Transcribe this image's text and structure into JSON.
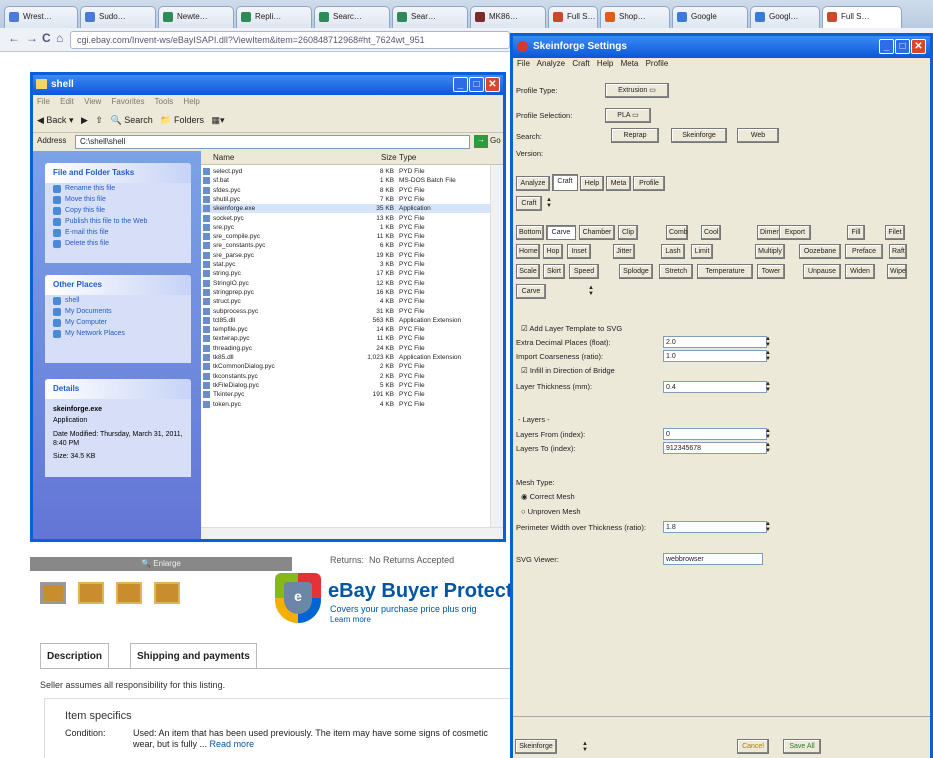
{
  "browser": {
    "tabs": [
      {
        "label": "Wrest…",
        "color": "#4b7bd4"
      },
      {
        "label": "Sudo…",
        "color": "#4b7bd4"
      },
      {
        "label": "Newte…",
        "color": "#2e8b57"
      },
      {
        "label": "Repli…",
        "color": "#2e8b57"
      },
      {
        "label": "Searc…",
        "color": "#2e8b57"
      },
      {
        "label": "Sear…",
        "color": "#2e8b57"
      },
      {
        "label": "MK86…",
        "color": "#7a2c2c"
      },
      {
        "label": "Full S…",
        "color": "#c94a2a"
      },
      {
        "label": "Shop…",
        "color": "#e35a1a"
      },
      {
        "label": "Google",
        "color": "#3a7bd5"
      },
      {
        "label": "Googl…",
        "color": "#3a7bd5"
      },
      {
        "label": "Full S…",
        "color": "#c94a2a"
      }
    ],
    "url": "cgi.ebay.com/Invent-ws/eBayISAPI.dll?ViewItem&item=260848712968#ht_7624wt_951"
  },
  "explorer": {
    "title": "shell",
    "menu": "File Edit View Favorites Tools Help",
    "toolbar": {
      "back": "Back",
      "search": "Search",
      "folders": "Folders"
    },
    "address_label": "Address",
    "address": "C:\\shell\\shell",
    "go": "Go",
    "file_tasks": {
      "title": "File and Folder Tasks",
      "items": [
        "Rename this file",
        "Move this file",
        "Copy this file",
        "Publish this file to the Web",
        "E-mail this file",
        "Delete this file"
      ]
    },
    "other_places": {
      "title": "Other Places",
      "items": [
        "shell",
        "My Documents",
        "My Computer",
        "My Network Places"
      ]
    },
    "details": {
      "title": "Details",
      "name": "skeinforge.exe",
      "type": "Application",
      "modified": "Date Modified: Thursday, March 31, 2011, 8:40 PM",
      "size": "Size: 34.5 KB"
    },
    "columns": {
      "name": "Name",
      "size": "Size",
      "type": "Type"
    },
    "files": [
      {
        "name": "select.pyd",
        "size": "8 KB",
        "type": "PYD File"
      },
      {
        "name": "sf.bat",
        "size": "1 KB",
        "type": "MS-DOS Batch File"
      },
      {
        "name": "sfdes.pyc",
        "size": "8 KB",
        "type": "PYC File"
      },
      {
        "name": "shutil.pyc",
        "size": "7 KB",
        "type": "PYC File"
      },
      {
        "name": "skeinforge.exe",
        "size": "35 KB",
        "type": "Application"
      },
      {
        "name": "socket.pyc",
        "size": "13 KB",
        "type": "PYC File"
      },
      {
        "name": "sre.pyc",
        "size": "1 KB",
        "type": "PYC File"
      },
      {
        "name": "sre_compile.pyc",
        "size": "11 KB",
        "type": "PYC File"
      },
      {
        "name": "sre_constants.pyc",
        "size": "6 KB",
        "type": "PYC File"
      },
      {
        "name": "sre_parse.pyc",
        "size": "19 KB",
        "type": "PYC File"
      },
      {
        "name": "stat.pyc",
        "size": "3 KB",
        "type": "PYC File"
      },
      {
        "name": "string.pyc",
        "size": "17 KB",
        "type": "PYC File"
      },
      {
        "name": "StringIO.pyc",
        "size": "12 KB",
        "type": "PYC File"
      },
      {
        "name": "stringprep.pyc",
        "size": "16 KB",
        "type": "PYC File"
      },
      {
        "name": "struct.pyc",
        "size": "4 KB",
        "type": "PYC File"
      },
      {
        "name": "subprocess.pyc",
        "size": "31 KB",
        "type": "PYC File"
      },
      {
        "name": "tcl85.dll",
        "size": "563 KB",
        "type": "Application Extension"
      },
      {
        "name": "tempfile.pyc",
        "size": "14 KB",
        "type": "PYC File"
      },
      {
        "name": "textwrap.pyc",
        "size": "11 KB",
        "type": "PYC File"
      },
      {
        "name": "threading.pyc",
        "size": "24 KB",
        "type": "PYC File"
      },
      {
        "name": "tk85.dll",
        "size": "1,023 KB",
        "type": "Application Extension"
      },
      {
        "name": "tkCommonDialog.pyc",
        "size": "2 KB",
        "type": "PYC File"
      },
      {
        "name": "tkconstants.pyc",
        "size": "2 KB",
        "type": "PYC File"
      },
      {
        "name": "tkFileDialog.pyc",
        "size": "5 KB",
        "type": "PYC File"
      },
      {
        "name": "Tkinter.pyc",
        "size": "191 KB",
        "type": "PYC File"
      },
      {
        "name": "token.pyc",
        "size": "4 KB",
        "type": "PYC File"
      }
    ]
  },
  "ebay": {
    "returns_label": "Returns:",
    "returns_value": "No Returns Accepted",
    "enlarge": "Enlarge",
    "buyer_protection": {
      "title": "eBay Buyer Protection",
      "subtitle": "Covers your purchase price plus orig",
      "link": "Learn more"
    },
    "tabs": [
      "Description",
      "Shipping and payments"
    ],
    "disclaimer": "Seller assumes all responsibility for this listing.",
    "item_specifics": "Item specifics",
    "condition_label": "Condition:",
    "condition_value": "Used: An item that has been used previously. The item may have some signs of cosmetic wear, but is fully ...",
    "read_more": "Read more"
  },
  "skeinforge": {
    "title": "Skeinforge Settings",
    "menu": "File Analyze Craft Help Meta Profile",
    "profile_type_label": "Profile Type:",
    "profile_type": "Extrusion",
    "profile_selection_label": "Profile Selection:",
    "profile_selection": "PLA",
    "search_label": "Search:",
    "search_buttons": [
      "Reprap",
      "Skeinforge",
      "Web"
    ],
    "version_label": "Version:",
    "main_tabs": [
      "Analyze",
      "Craft",
      "Help",
      "Meta",
      "Profile"
    ],
    "craft_button": "Craft",
    "plugins": [
      "Bottom",
      "Carve",
      "Chamber",
      "Clip",
      "Comb",
      "Cool",
      "Dimension",
      "Export",
      "Fill",
      "Filet",
      "Home",
      "Hop",
      "Inset",
      "Jitter",
      "Lash",
      "Limit",
      "Multiply",
      "Oozebane",
      "Preface",
      "Raft",
      "Scale",
      "Skirt",
      "Speed",
      "Splodge",
      "Stretch",
      "Temperature",
      "Tower",
      "Unpause",
      "Widen",
      "Wipe"
    ],
    "plugin_menu": "Carve",
    "settings": {
      "add_layer_template": "Add Layer Template to SVG",
      "extra_decimal_label": "Extra Decimal Places (float):",
      "extra_decimal": "2.0",
      "import_coarseness_label": "Import Coarseness (ratio):",
      "import_coarseness": "1.0",
      "infill_bridge": "Infill in Direction of Bridge",
      "layer_thickness_label": "Layer Thickness (mm):",
      "layer_thickness": "0.4",
      "layers_heading": "- Layers -",
      "layers_from_label": "Layers From (index):",
      "layers_from": "0",
      "layers_to_label": "Layers To (index):",
      "layers_to": "912345678",
      "mesh_type_label": "Mesh Type:",
      "correct_mesh": "Correct Mesh",
      "unproven_mesh": "Unproven Mesh",
      "perimeter_label": "Perimeter Width over Thickness (ratio):",
      "perimeter": "1.8",
      "svg_viewer_label": "SVG Viewer:",
      "svg_viewer": "webbrowser"
    },
    "bottom_menu": "Skeinforge",
    "cancel": "Cancel",
    "save_all": "Save All"
  }
}
